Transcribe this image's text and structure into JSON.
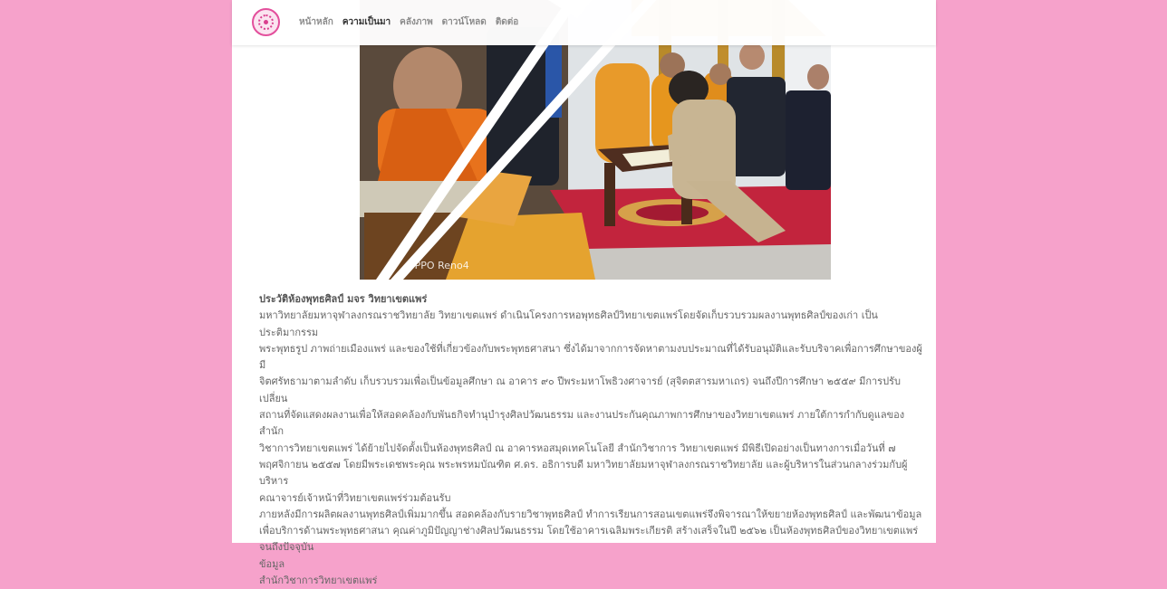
{
  "navigation": {
    "menu": [
      "หน้าหลัก",
      "ความเป็นมา",
      "คลังภาพ",
      "ดาวน์โหลด",
      "ติดต่อ"
    ]
  },
  "photo": {
    "watermark": "OPPO Reno4"
  },
  "article": {
    "title": "ประวัติห้องพุทธศิลป์ มจร วิทยาเขตแพร่",
    "lines": [
      "มหาวิทยาลัยมหาจุฬาลงกรณราชวิทยาลัย วิทยาเขตแพร่ ดำเนินโครงการหอพุทธศิลป์วิทยาเขตแพร่โดยจัดเก็บรวบรวมผลงานพุทธศิลป์ของเก่า เป็นประติมากรรม",
      "พระพุทธรูป ภาพถ่ายเมืองแพร่ และของใช้ที่เกี่ยวข้องกับพระพุทธศาสนา ซึ่งได้มาจากการจัดหาตามงบประมาณที่ได้รับอนุมัติและรับบริจาคเพื่อการศึกษาของผู้มี",
      "จิตศรัทธามาตามลำดับ เก็บรวบรวมเพื่อเป็นข้อมูลศึกษา ณ อาคาร ๙๐ ปีพระมหาโพธิวงศาจารย์ (สุจิตตสารมหาเถร) จนถึงปีการศึกษา ๒๕๕๙ มีการปรับเปลี่ยน",
      "สถานที่จัดแสดงผลงานเพื่อให้สอดคล้องกับพันธกิจทำนุบำรุงศิลปวัฒนธรรม และงานประกันคุณภาพการศึกษาของวิทยาเขตแพร่ ภายใต้การกำกับดูแลของ สำนัก",
      "วิชาการวิทยาเขตแพร่ ได้ย้ายไปจัดตั้งเป็นห้องพุทธศิลป์ ณ อาคารหอสมุดเทคโนโลยี สำนักวิชาการ วิทยาเขตแพร่ มีพิธีเปิดอย่างเป็นทางการเมื่อวันที่ ๗",
      "พฤศจิกายน ๒๕๕๗ โดยมีพระเดชพระคุณ พระพรหมบัณฑิต ศ.ดร. อธิการบดี มหาวิทยาลัยมหาจุฬาลงกรณราชวิทยาลัย และผู้บริหารในส่วนกลางร่วมกับผู้บริหาร",
      "คณาจารย์เจ้าหน้าที่วิทยาเขตแพร่ร่วมต้อนรับ",
      "ภายหลังมีการผลิตผลงานพุทธศิลป์เพิ่มมากขึ้น สอดคล้องกับรายวิชาพุทธศิลป์ ทำการเรียนการสอนเขตแพร่จึงพิจารณาให้ขยายห้องพุทธศิลป์ และพัฒนาข้อมูล",
      "เพื่อบริการด้านพระพุทธศาสนา คุณค่าภูมิปัญญาช่างศิลปวัฒนธรรม โดยใช้อาคารเฉลิมพระเกียรติ สร้างเสร็จในปี ๒๕๖๒ เป็นห้องพุทธศิลป์ของวิทยาเขตแพร่",
      "จนถึงปัจจุบัน",
      "ข้อมูล",
      "สำนักวิชาการวิทยาเขตแพร่"
    ]
  }
}
